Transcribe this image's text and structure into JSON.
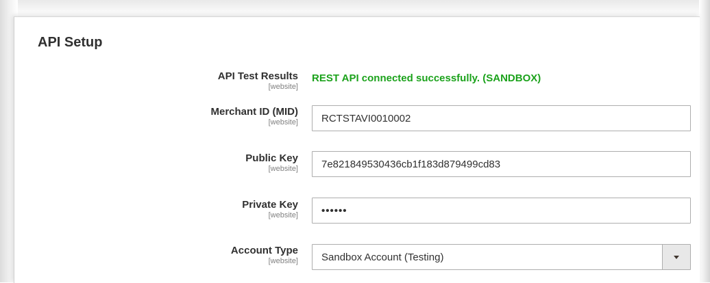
{
  "section": {
    "title": "API Setup"
  },
  "fields": {
    "api_test_results": {
      "label": "API Test Results",
      "scope": "[website]",
      "value": "REST API connected successfully. (SANDBOX)",
      "status_color": "#1ba21b"
    },
    "merchant_id": {
      "label": "Merchant ID (MID)",
      "scope": "[website]",
      "value": "RCTSTAVI0010002"
    },
    "public_key": {
      "label": "Public Key",
      "scope": "[website]",
      "value": "7e821849530436cb1f183d879499cd83"
    },
    "private_key": {
      "label": "Private Key",
      "scope": "[website]",
      "value": "••••••",
      "masked": true
    },
    "account_type": {
      "label": "Account Type",
      "scope": "[website]",
      "selected": "Sandbox Account (Testing)",
      "arrow_icon": "chevron-down-icon"
    }
  }
}
